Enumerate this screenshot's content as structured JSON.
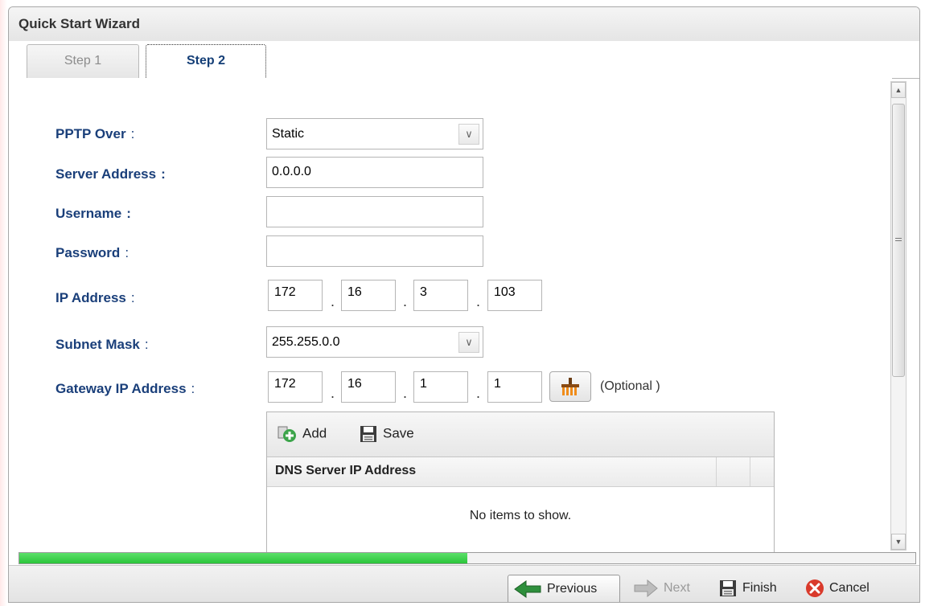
{
  "window": {
    "title": "Quick Start Wizard"
  },
  "tabs": [
    {
      "label": "Step 1",
      "active": false
    },
    {
      "label": "Step 2",
      "active": true
    }
  ],
  "form": {
    "pptp_over": {
      "label": "PPTP Over",
      "colon": ":",
      "value": "Static"
    },
    "server_address": {
      "label": "Server Address",
      "colon": ":",
      "value": "0.0.0.0"
    },
    "username": {
      "label": "Username",
      "colon": ":",
      "value": ""
    },
    "password": {
      "label": "Password",
      "colon": ":",
      "value": ""
    },
    "ip_address": {
      "label": "IP Address",
      "colon": ":",
      "octets": [
        "172",
        "16",
        "3",
        "103"
      ]
    },
    "subnet_mask": {
      "label": "Subnet Mask",
      "colon": ":",
      "value": "255.255.0.0"
    },
    "gateway": {
      "label": "Gateway IP Address",
      "colon": ":",
      "octets": [
        "172",
        "16",
        "1",
        "1"
      ],
      "optional_text": "(Optional )"
    },
    "separator": "."
  },
  "dns_grid": {
    "toolbar": {
      "add_label": "Add",
      "save_label": "Save"
    },
    "column_header": "DNS Server IP Address",
    "empty_text": "No items to show."
  },
  "progress": {
    "fraction": 0.5
  },
  "footer": {
    "previous_label": "Previous",
    "next_label": "Next",
    "finish_label": "Finish",
    "cancel_label": "Cancel"
  },
  "colors": {
    "label_blue": "#1a3f7a",
    "progress_green": "#2bc43a",
    "cancel_red": "#d93a2b"
  }
}
